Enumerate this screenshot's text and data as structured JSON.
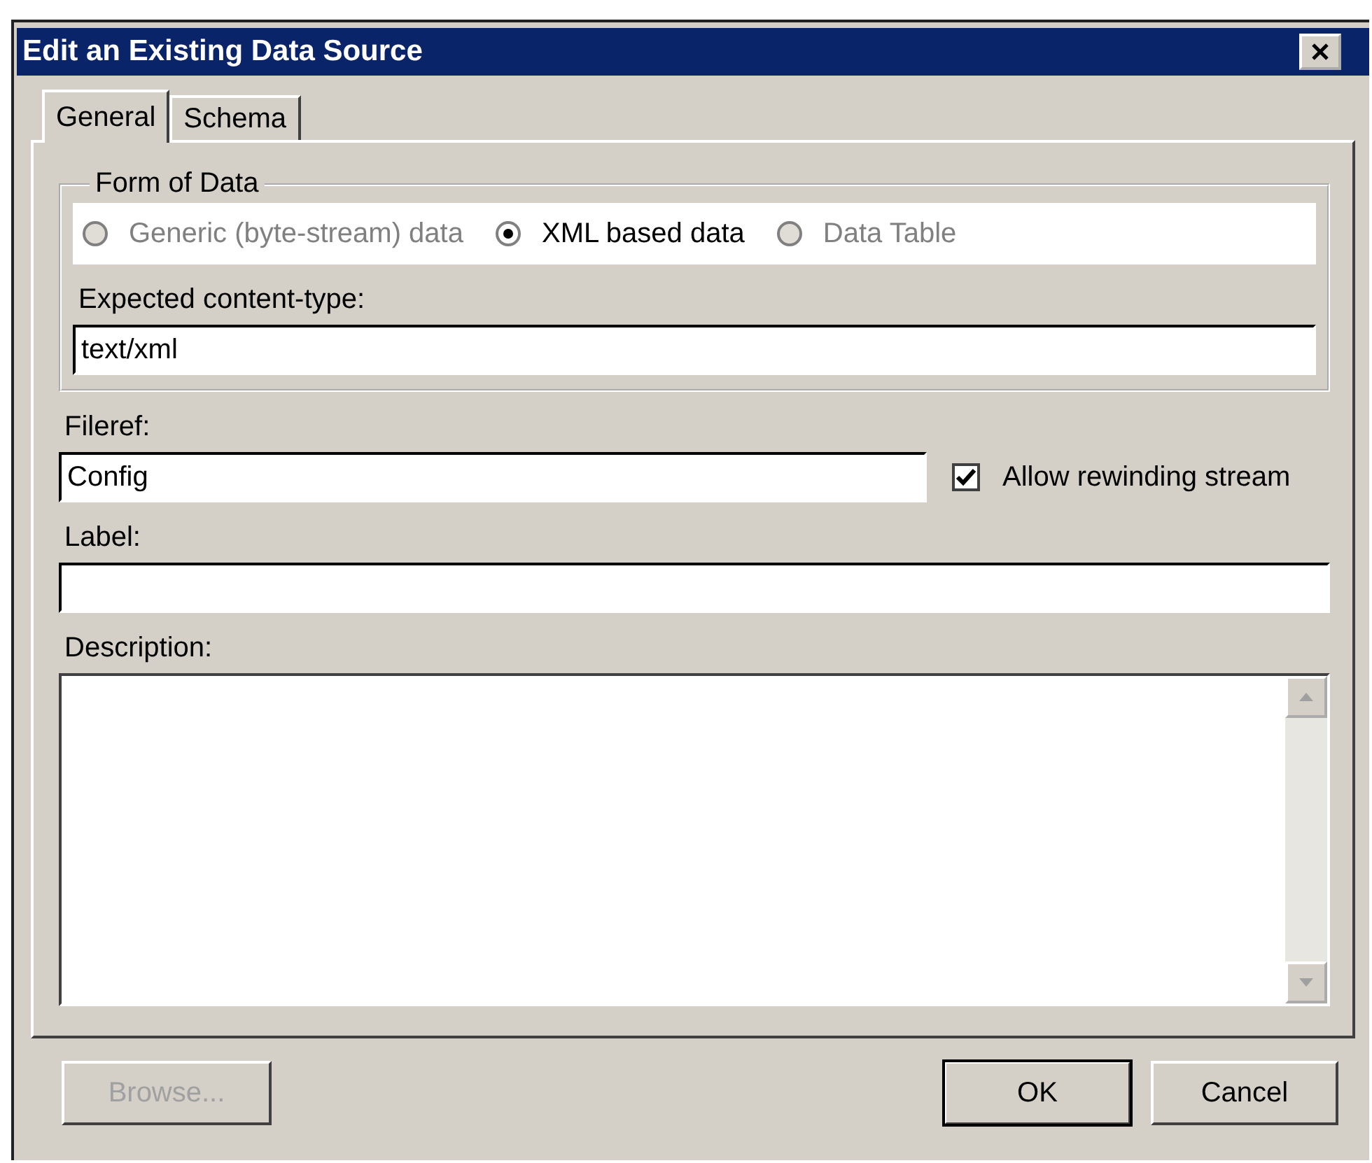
{
  "window": {
    "title": "Edit an Existing Data Source"
  },
  "tabs": [
    {
      "label": "General",
      "selected": true
    },
    {
      "label": "Schema",
      "selected": false
    }
  ],
  "form_of_data": {
    "title": "Form of Data",
    "options": [
      {
        "label": "Generic (byte-stream) data",
        "selected": false,
        "disabled": true
      },
      {
        "label": "XML based data",
        "selected": true,
        "disabled": false
      },
      {
        "label": "Data Table",
        "selected": false,
        "disabled": true
      }
    ],
    "content_type": {
      "label": "Expected content-type:",
      "value": "text/xml"
    }
  },
  "fileref": {
    "label": "Fileref:",
    "value": "Config"
  },
  "allow_rewinding": {
    "label": "Allow rewinding stream",
    "checked": true
  },
  "label_field": {
    "label": "Label:"
  },
  "description": {
    "label": "Description:"
  },
  "buttons": [
    {
      "label": "Browse...",
      "disabled": true
    },
    {
      "label": "OK",
      "disabled": false,
      "default": true
    },
    {
      "label": "Cancel",
      "disabled": false,
      "default": false
    }
  ]
}
